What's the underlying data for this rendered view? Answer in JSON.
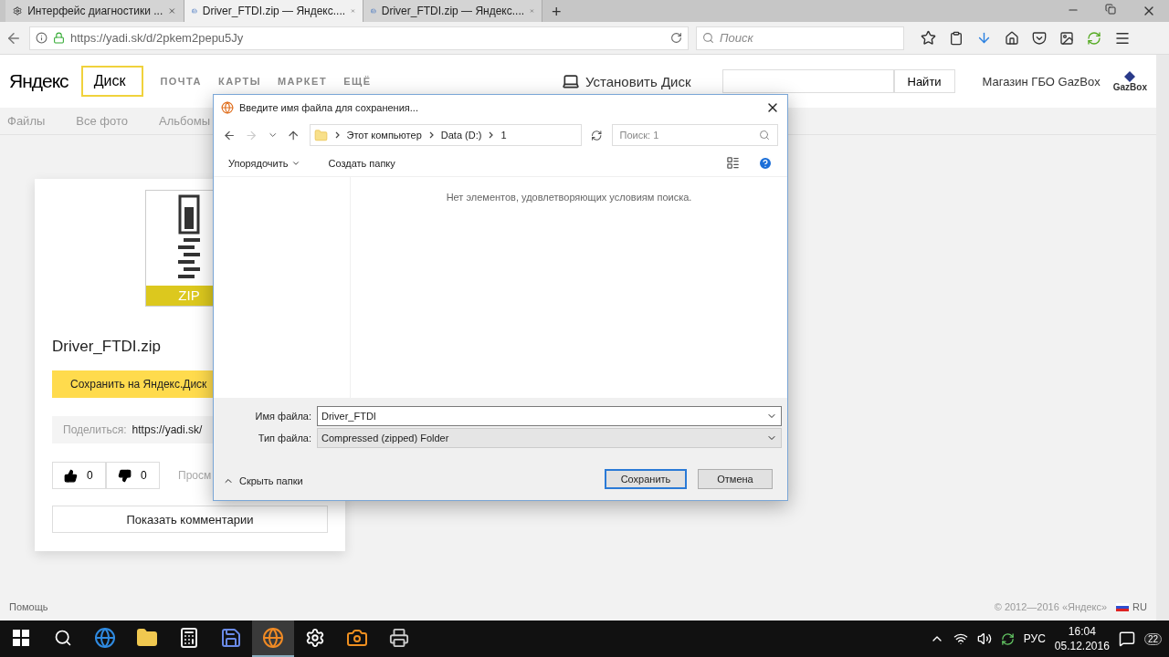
{
  "browser": {
    "tabs": [
      {
        "kind": "site",
        "label": "Интерфейс диагностики ...",
        "selected": false
      },
      {
        "kind": "disk",
        "label": "Driver_FTDI.zip — Яндекс....",
        "selected": true
      },
      {
        "kind": "disk",
        "label": "Driver_FTDI.zip — Яндекс....",
        "selected": false
      }
    ],
    "new_tab": "+",
    "url": "https://yadi.sk/d/2pkem2pepu5Jy",
    "search_placeholder": "Поиск"
  },
  "site": {
    "logo": "Яндекс",
    "service": "Диск",
    "nav": [
      "ПОЧТА",
      "КАРТЫ",
      "МАРКЕТ",
      "ЕЩЁ"
    ],
    "install": "Установить Диск",
    "search_button": "Найти",
    "ad": "Магазин ГБО GazBox",
    "ad_logo": "GazBox",
    "subnav": [
      "Файлы",
      "Все фото",
      "Альбомы"
    ],
    "file": {
      "badge": "ZIP",
      "name": "Driver_FTDI.zip",
      "save_button": "Сохранить на Яндекс.Диск",
      "share_label": "Поделиться:",
      "share_link": "https://yadi.sk/",
      "likes": "0",
      "dislikes": "0",
      "views": "Просм",
      "comments_button": "Показать комментарии"
    },
    "footer": {
      "help": "Помощь",
      "copyright": "© 2012—2016 «Яндекс»",
      "lang": "RU"
    }
  },
  "dialog": {
    "title": "Введите имя файла для сохранения...",
    "path": [
      "Этот компьютер",
      "Data (D:)",
      "1"
    ],
    "search_placeholder": "Поиск: 1",
    "toolbar": [
      "Упорядочить",
      "Создать папку"
    ],
    "empty": "Нет элементов, удовлетворяющих условиям поиска.",
    "filename_label": "Имя файла:",
    "filename": "Driver_FTDI",
    "type_label": "Тип файла:",
    "type": "Compressed (zipped) Folder",
    "hide_folders": "Скрыть папки",
    "buttons": [
      {
        "label": "Сохранить",
        "focused": true
      },
      {
        "label": "Отмена",
        "focused": false
      }
    ]
  },
  "taskbar": {
    "apps": [
      {
        "kind": "edge",
        "selected": false
      },
      {
        "kind": "folder",
        "selected": false
      },
      {
        "kind": "calculator",
        "selected": false
      },
      {
        "kind": "save",
        "selected": false
      },
      {
        "kind": "firefox",
        "selected": true
      },
      {
        "kind": "settings",
        "selected": false
      },
      {
        "kind": "camera",
        "selected": false
      },
      {
        "kind": "printer",
        "selected": false
      }
    ],
    "lang": "РУС",
    "time": "16:04",
    "date": "05.12.2016",
    "notifications": "22"
  }
}
